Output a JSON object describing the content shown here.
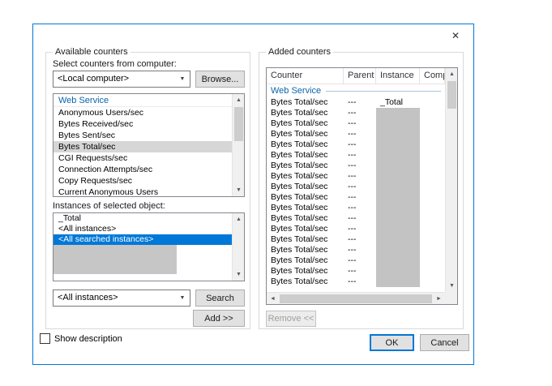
{
  "dialog": {
    "close_glyph": "✕"
  },
  "available": {
    "group_label": "Available counters",
    "select_computer_label": "Select counters from computer:",
    "computer_value": "<Local computer>",
    "browse_label": "Browse...",
    "counters_group_header": "Web Service",
    "collapse_glyph": "^",
    "counters": [
      "Anonymous Users/sec",
      "Bytes Received/sec",
      "Bytes Sent/sec",
      "Bytes Total/sec",
      "CGI Requests/sec",
      "Connection Attempts/sec",
      "Copy Requests/sec",
      "Current Anonymous Users"
    ],
    "selected_counter": "Bytes Total/sec",
    "instances_label": "Instances of selected object:",
    "instances": [
      "_Total",
      "<All instances>",
      "<All searched instances>"
    ],
    "selected_instance": "<All searched instances>",
    "instance_filter_value": "<All instances>",
    "search_label": "Search",
    "add_label": "Add >>"
  },
  "added": {
    "group_label": "Added counters",
    "columns": [
      "Counter",
      "Parent",
      "Instance",
      "Comp"
    ],
    "group_header": "Web Service",
    "rows": [
      {
        "counter": "Bytes Total/sec",
        "parent": "---",
        "instance": "_Total",
        "gray": false
      },
      {
        "counter": "Bytes Total/sec",
        "parent": "---",
        "instance": "",
        "gray": true
      },
      {
        "counter": "Bytes Total/sec",
        "parent": "---",
        "instance": "",
        "gray": true
      },
      {
        "counter": "Bytes Total/sec",
        "parent": "---",
        "instance": "",
        "gray": true
      },
      {
        "counter": "Bytes Total/sec",
        "parent": "---",
        "instance": "",
        "gray": true
      },
      {
        "counter": "Bytes Total/sec",
        "parent": "---",
        "instance": "",
        "gray": true
      },
      {
        "counter": "Bytes Total/sec",
        "parent": "---",
        "instance": "",
        "gray": true
      },
      {
        "counter": "Bytes Total/sec",
        "parent": "---",
        "instance": "",
        "gray": true
      },
      {
        "counter": "Bytes Total/sec",
        "parent": "---",
        "instance": "",
        "gray": true
      },
      {
        "counter": "Bytes Total/sec",
        "parent": "---",
        "instance": "",
        "gray": true
      },
      {
        "counter": "Bytes Total/sec",
        "parent": "---",
        "instance": "",
        "gray": true
      },
      {
        "counter": "Bytes Total/sec",
        "parent": "---",
        "instance": "",
        "gray": true
      },
      {
        "counter": "Bytes Total/sec",
        "parent": "---",
        "instance": "",
        "gray": true
      },
      {
        "counter": "Bytes Total/sec",
        "parent": "---",
        "instance": "",
        "gray": true
      },
      {
        "counter": "Bytes Total/sec",
        "parent": "---",
        "instance": "",
        "gray": true
      },
      {
        "counter": "Bytes Total/sec",
        "parent": "---",
        "instance": "",
        "gray": true
      },
      {
        "counter": "Bytes Total/sec",
        "parent": "---",
        "instance": "",
        "gray": true
      },
      {
        "counter": "Bytes Total/sec",
        "parent": "---",
        "instance": "",
        "gray": true
      }
    ],
    "remove_label": "Remove <<"
  },
  "footer": {
    "show_description_label": "Show description",
    "ok_label": "OK",
    "cancel_label": "Cancel"
  }
}
